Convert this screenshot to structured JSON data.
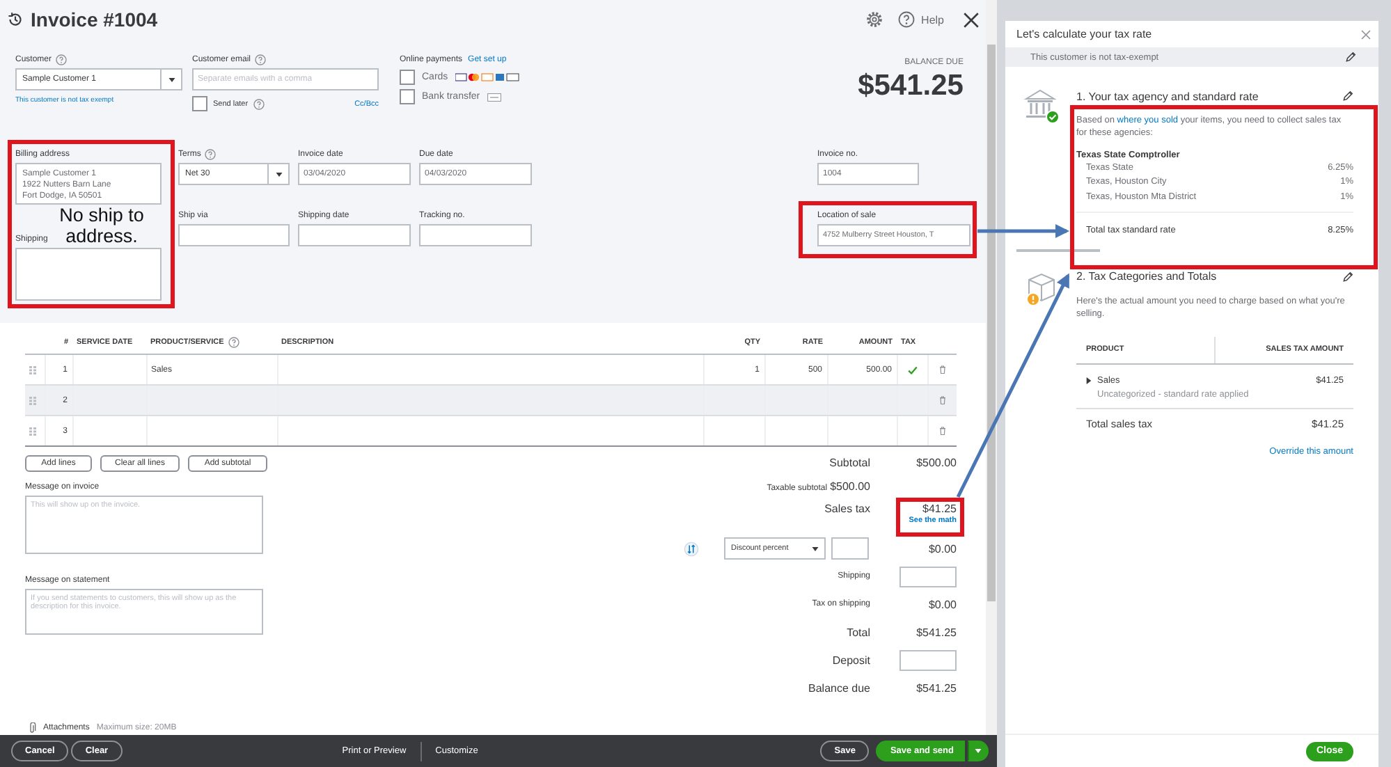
{
  "header": {
    "title": "Invoice #1004",
    "help": "Help"
  },
  "customer": {
    "label": "Customer",
    "value": "Sample  Customer 1",
    "note": "This customer is not tax exempt"
  },
  "customer_email": {
    "label": "Customer email",
    "placeholder": "Separate emails with a comma",
    "send_later": {
      "label": "Send later",
      "checked": false
    },
    "cc_bcc": "Cc/Bcc"
  },
  "online_payments": {
    "label": "Online payments",
    "link": "Get set up",
    "options": [
      {
        "kind": "cards",
        "label": "Cards",
        "checked": false
      },
      {
        "kind": "bank",
        "label": "Bank transfer",
        "checked": false
      }
    ]
  },
  "balance_due": {
    "label": "BALANCE DUE",
    "amount": "$541.25"
  },
  "billing_address": {
    "label": "Billing address",
    "lines": [
      "Sample Customer 1",
      "1922  Nutters Barn Lane",
      "Fort Dodge, IA  50501"
    ]
  },
  "shipping_address": {
    "label": "Shipping"
  },
  "fields": [
    {
      "kind": "select",
      "label": "Terms",
      "value": "Net 30",
      "help": true
    },
    {
      "kind": "text",
      "label": "Invoice date",
      "value": "03/04/2020",
      "help": false
    },
    {
      "kind": "text",
      "label": "Due date",
      "value": "04/03/2020",
      "help": false
    },
    {
      "kind": "text",
      "label": "Ship via",
      "help": false
    },
    {
      "kind": "text",
      "label": "Shipping date",
      "help": false
    },
    {
      "kind": "text",
      "label": "Tracking no.",
      "help": false
    }
  ],
  "invoice_no": {
    "label": "Invoice no.",
    "value": "1004"
  },
  "location_of_sale": {
    "label": "Location of sale",
    "value": "4752  Mulberry Street Houston, T"
  },
  "table": {
    "columns": [
      "#",
      "SERVICE DATE",
      "PRODUCT/SERVICE",
      "DESCRIPTION",
      "QTY",
      "RATE",
      "AMOUNT",
      "TAX"
    ],
    "rows": [
      {
        "num": "1",
        "product": "Sales",
        "qty": "1",
        "rate": "500",
        "amount": "500.00",
        "taxable": true,
        "selected": false
      },
      {
        "num": "2",
        "taxable": false,
        "selected": true
      },
      {
        "num": "3",
        "taxable": false,
        "selected": false
      }
    ]
  },
  "line_buttons": [
    "Add lines",
    "Clear all lines",
    "Add subtotal"
  ],
  "message_on_invoice": {
    "label": "Message on invoice",
    "placeholder": "This will show up on the invoice."
  },
  "message_on_statement": {
    "label": "Message on statement",
    "placeholder": "If you send statements to customers, this will show up as the description for this invoice."
  },
  "totals": {
    "subtotal": {
      "label": "Subtotal",
      "value": "$500.00"
    },
    "taxable_subtotal": {
      "label": "Taxable subtotal",
      "value": "$500.00"
    },
    "sales_tax": {
      "label": "Sales tax",
      "value": "$41.25",
      "link": "See the math"
    },
    "discount": {
      "type": "Discount percent",
      "value": "$0.00"
    },
    "shipping": {
      "label": "Shipping"
    },
    "tax_on_shipping": {
      "label": "Tax on shipping",
      "value": "$0.00"
    },
    "total": {
      "label": "Total",
      "value": "$541.25"
    },
    "deposit": {
      "label": "Deposit"
    },
    "balance_due": {
      "label": "Balance due",
      "value": "$541.25"
    }
  },
  "attachments": {
    "label": "Attachments",
    "note": "Maximum size: 20MB"
  },
  "footer": {
    "cancel": "Cancel",
    "clear": "Clear",
    "print": "Print or Preview",
    "customize": "Customize",
    "save": "Save",
    "save_and_send": "Save and send"
  },
  "tax_panel": {
    "title": "Let's calculate your tax rate",
    "exempt": "This customer is not tax-exempt",
    "agency_section": {
      "title": "1. Your tax agency and standard rate",
      "intro_before": "Based on",
      "intro_link": "where you sold",
      "intro_after": "your items, you need to collect sales tax for these agencies:",
      "agency": "Texas State Comptroller",
      "rates": [
        {
          "name": "Texas State",
          "rate": "6.25%"
        },
        {
          "name": "Texas, Houston City",
          "rate": "1%"
        },
        {
          "name": "Texas, Houston Mta District",
          "rate": "1%"
        }
      ],
      "total_label": "Total tax standard rate",
      "total": "8.25%"
    },
    "categories_section": {
      "title": "2. Tax Categories and Totals",
      "intro": "Here's the actual amount you need to charge based on what you're selling.",
      "columns": [
        "PRODUCT",
        "SALES TAX AMOUNT"
      ],
      "rows": [
        {
          "product": "Sales",
          "note": "Uncategorized - standard rate applied",
          "amount": "$41.25",
          "expanded": false
        }
      ],
      "total_label": "Total sales tax",
      "total": "$41.25",
      "link": "Override this amount"
    },
    "close": "Close"
  },
  "annotation": {
    "note": "No ship to address."
  }
}
